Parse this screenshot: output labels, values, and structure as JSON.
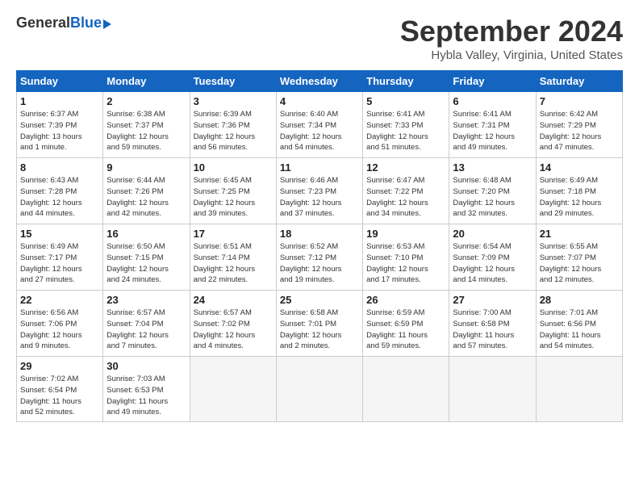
{
  "header": {
    "logo_general": "General",
    "logo_blue": "Blue",
    "month_title": "September 2024",
    "location": "Hybla Valley, Virginia, United States"
  },
  "days_of_week": [
    "Sunday",
    "Monday",
    "Tuesday",
    "Wednesday",
    "Thursday",
    "Friday",
    "Saturday"
  ],
  "weeks": [
    [
      {
        "day": "1",
        "info": "Sunrise: 6:37 AM\nSunset: 7:39 PM\nDaylight: 13 hours\nand 1 minute."
      },
      {
        "day": "2",
        "info": "Sunrise: 6:38 AM\nSunset: 7:37 PM\nDaylight: 12 hours\nand 59 minutes."
      },
      {
        "day": "3",
        "info": "Sunrise: 6:39 AM\nSunset: 7:36 PM\nDaylight: 12 hours\nand 56 minutes."
      },
      {
        "day": "4",
        "info": "Sunrise: 6:40 AM\nSunset: 7:34 PM\nDaylight: 12 hours\nand 54 minutes."
      },
      {
        "day": "5",
        "info": "Sunrise: 6:41 AM\nSunset: 7:33 PM\nDaylight: 12 hours\nand 51 minutes."
      },
      {
        "day": "6",
        "info": "Sunrise: 6:41 AM\nSunset: 7:31 PM\nDaylight: 12 hours\nand 49 minutes."
      },
      {
        "day": "7",
        "info": "Sunrise: 6:42 AM\nSunset: 7:29 PM\nDaylight: 12 hours\nand 47 minutes."
      }
    ],
    [
      {
        "day": "8",
        "info": "Sunrise: 6:43 AM\nSunset: 7:28 PM\nDaylight: 12 hours\nand 44 minutes."
      },
      {
        "day": "9",
        "info": "Sunrise: 6:44 AM\nSunset: 7:26 PM\nDaylight: 12 hours\nand 42 minutes."
      },
      {
        "day": "10",
        "info": "Sunrise: 6:45 AM\nSunset: 7:25 PM\nDaylight: 12 hours\nand 39 minutes."
      },
      {
        "day": "11",
        "info": "Sunrise: 6:46 AM\nSunset: 7:23 PM\nDaylight: 12 hours\nand 37 minutes."
      },
      {
        "day": "12",
        "info": "Sunrise: 6:47 AM\nSunset: 7:22 PM\nDaylight: 12 hours\nand 34 minutes."
      },
      {
        "day": "13",
        "info": "Sunrise: 6:48 AM\nSunset: 7:20 PM\nDaylight: 12 hours\nand 32 minutes."
      },
      {
        "day": "14",
        "info": "Sunrise: 6:49 AM\nSunset: 7:18 PM\nDaylight: 12 hours\nand 29 minutes."
      }
    ],
    [
      {
        "day": "15",
        "info": "Sunrise: 6:49 AM\nSunset: 7:17 PM\nDaylight: 12 hours\nand 27 minutes."
      },
      {
        "day": "16",
        "info": "Sunrise: 6:50 AM\nSunset: 7:15 PM\nDaylight: 12 hours\nand 24 minutes."
      },
      {
        "day": "17",
        "info": "Sunrise: 6:51 AM\nSunset: 7:14 PM\nDaylight: 12 hours\nand 22 minutes."
      },
      {
        "day": "18",
        "info": "Sunrise: 6:52 AM\nSunset: 7:12 PM\nDaylight: 12 hours\nand 19 minutes."
      },
      {
        "day": "19",
        "info": "Sunrise: 6:53 AM\nSunset: 7:10 PM\nDaylight: 12 hours\nand 17 minutes."
      },
      {
        "day": "20",
        "info": "Sunrise: 6:54 AM\nSunset: 7:09 PM\nDaylight: 12 hours\nand 14 minutes."
      },
      {
        "day": "21",
        "info": "Sunrise: 6:55 AM\nSunset: 7:07 PM\nDaylight: 12 hours\nand 12 minutes."
      }
    ],
    [
      {
        "day": "22",
        "info": "Sunrise: 6:56 AM\nSunset: 7:06 PM\nDaylight: 12 hours\nand 9 minutes."
      },
      {
        "day": "23",
        "info": "Sunrise: 6:57 AM\nSunset: 7:04 PM\nDaylight: 12 hours\nand 7 minutes."
      },
      {
        "day": "24",
        "info": "Sunrise: 6:57 AM\nSunset: 7:02 PM\nDaylight: 12 hours\nand 4 minutes."
      },
      {
        "day": "25",
        "info": "Sunrise: 6:58 AM\nSunset: 7:01 PM\nDaylight: 12 hours\nand 2 minutes."
      },
      {
        "day": "26",
        "info": "Sunrise: 6:59 AM\nSunset: 6:59 PM\nDaylight: 11 hours\nand 59 minutes."
      },
      {
        "day": "27",
        "info": "Sunrise: 7:00 AM\nSunset: 6:58 PM\nDaylight: 11 hours\nand 57 minutes."
      },
      {
        "day": "28",
        "info": "Sunrise: 7:01 AM\nSunset: 6:56 PM\nDaylight: 11 hours\nand 54 minutes."
      }
    ],
    [
      {
        "day": "29",
        "info": "Sunrise: 7:02 AM\nSunset: 6:54 PM\nDaylight: 11 hours\nand 52 minutes."
      },
      {
        "day": "30",
        "info": "Sunrise: 7:03 AM\nSunset: 6:53 PM\nDaylight: 11 hours\nand 49 minutes."
      },
      {
        "day": "",
        "info": ""
      },
      {
        "day": "",
        "info": ""
      },
      {
        "day": "",
        "info": ""
      },
      {
        "day": "",
        "info": ""
      },
      {
        "day": "",
        "info": ""
      }
    ]
  ]
}
